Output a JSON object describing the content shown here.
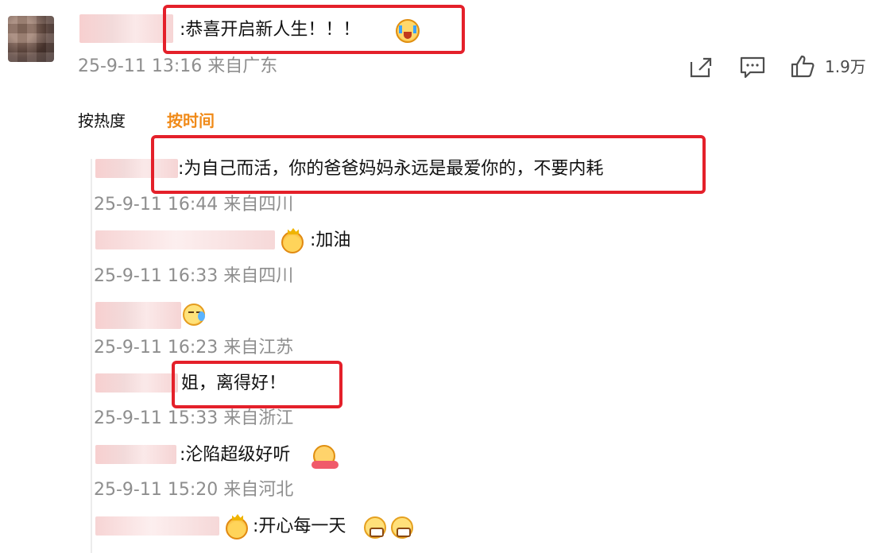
{
  "post": {
    "text": ":恭喜开启新人生！！！",
    "meta": "25-9-11 13:16 来自广东",
    "likes": "1.9万",
    "icons": [
      "share-icon",
      "comment-icon",
      "like-icon"
    ]
  },
  "sort_tabs": {
    "by_heat": "按热度",
    "by_time": "按时间",
    "active": "by_time",
    "active_color": "#f08a18"
  },
  "replies": [
    {
      "text": ":为自己而活，你的爸爸妈妈永远是最爱你的，不要内耗",
      "meta": "25-9-11 16:44 来自四川"
    },
    {
      "text": ":加油",
      "meta": "25-9-11 16:33 来自四川",
      "badge": "crown-emoji"
    },
    {
      "text": "",
      "meta": "25-9-11 16:23 来自江苏",
      "emoji": "sleepy-emoji"
    },
    {
      "text": "姐，离得好！",
      "meta": "25-9-11 15:33 来自浙江"
    },
    {
      "text": ":沦陷超级好听",
      "meta": "25-9-11 15:20 来自河北",
      "emoji": "hug-emoji"
    },
    {
      "text": ":开心每一天",
      "meta": "",
      "badge": "crown-emoji",
      "emoji": "grin-emoji"
    }
  ],
  "highlight_color": "#e4202a"
}
